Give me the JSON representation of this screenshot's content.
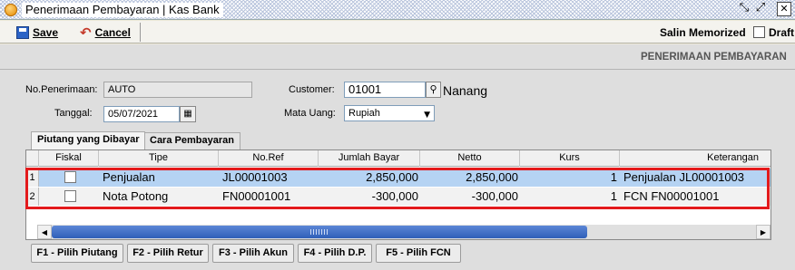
{
  "window": {
    "title": "Penerimaan Pembayaran | Kas Bank",
    "restore_glyph": "⤡",
    "maximize_glyph": "⤢",
    "close_glyph": "✕"
  },
  "toolbar": {
    "save_label": "Save",
    "cancel_label": "Cancel",
    "salin_memorized_label": "Salin Memorized",
    "draft_label": "Draft",
    "draft_checked": false
  },
  "form": {
    "section_title": "PENERIMAAN PEMBAYARAN",
    "no_penerimaan_label": "No.Penerimaan:",
    "no_penerimaan_value": "AUTO",
    "tanggal_label": "Tanggal:",
    "tanggal_value": "05/07/2021",
    "customer_label": "Customer:",
    "customer_value": "01001",
    "customer_name": "Nanang",
    "mata_uang_label": "Mata Uang:",
    "mata_uang_value": "Rupiah"
  },
  "tabs": [
    {
      "label": "Piutang yang Dibayar",
      "active": true
    },
    {
      "label": "Cara Pembayaran",
      "active": false
    }
  ],
  "grid": {
    "columns": [
      "Fiskal",
      "Tipe",
      "No.Ref",
      "Jumlah Bayar",
      "Netto",
      "Kurs",
      "Keterangan"
    ],
    "rows": [
      {
        "num": "1",
        "fiskal": false,
        "tipe": "Penjualan",
        "no_ref": "JL00001003",
        "jumlah_bayar": "2,850,000",
        "netto": "2,850,000",
        "kurs": "1",
        "keterangan": "Penjualan JL00001003",
        "selected": true
      },
      {
        "num": "2",
        "fiskal": false,
        "tipe": "Nota Potong",
        "no_ref": "FN00001001",
        "jumlah_bayar": "-300,000",
        "netto": "-300,000",
        "kurs": "1",
        "keterangan": "FCN FN00001001",
        "selected": false
      }
    ]
  },
  "function_buttons": [
    "F1 - Pilih Piutang",
    "F2 - Pilih Retur",
    "F3 - Pilih Akun",
    "F4 - Pilih D.P.",
    "F5 - Pilih FCN"
  ],
  "colors": {
    "highlight_border": "#e31a1c",
    "selected_row": "#b5d3f3",
    "scroll_thumb": "#3a68c4"
  }
}
